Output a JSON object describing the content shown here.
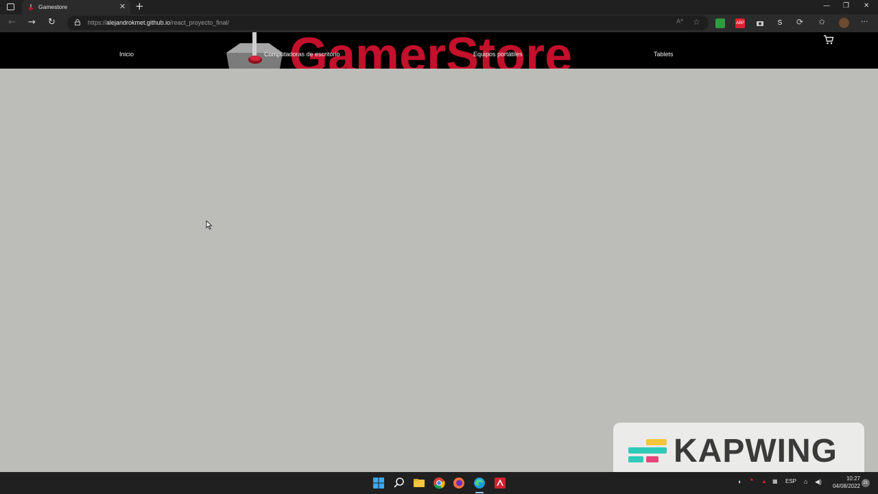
{
  "browser": {
    "tab": {
      "title": "Gamestore",
      "close_label": "✕"
    },
    "new_tab_label": "+",
    "window_controls": [
      "—",
      "❐",
      "✕"
    ],
    "url": {
      "scheme": "https://",
      "host": "alejandrokmet.github.io",
      "path": "/react_proyecto_final/"
    },
    "extensions": [
      {
        "name": "ext-green-icon",
        "label": "",
        "color": "#2e9d3d"
      },
      {
        "name": "ext-abp-icon",
        "label": "ABP",
        "color": "#e0202f"
      },
      {
        "name": "ext-camera-icon",
        "label": "",
        "color": "#555555"
      },
      {
        "name": "ext-s-icon",
        "label": "S",
        "color": "#2b2b2b"
      }
    ]
  },
  "site": {
    "brand": "GamerStore",
    "brand_color": "#c3102b",
    "nav": [
      "Inicio",
      "Computadoras de escritorio",
      "Equipos portátiles",
      "Tablets"
    ],
    "cart_icon": "cart-icon"
  },
  "page": {
    "background": "#bcbdb8"
  },
  "watermark": {
    "text": "KAPWING"
  },
  "taskbar": {
    "tray_language": "ESP",
    "time": "10:27",
    "date": "04/08/2022",
    "notification_count": "21"
  }
}
